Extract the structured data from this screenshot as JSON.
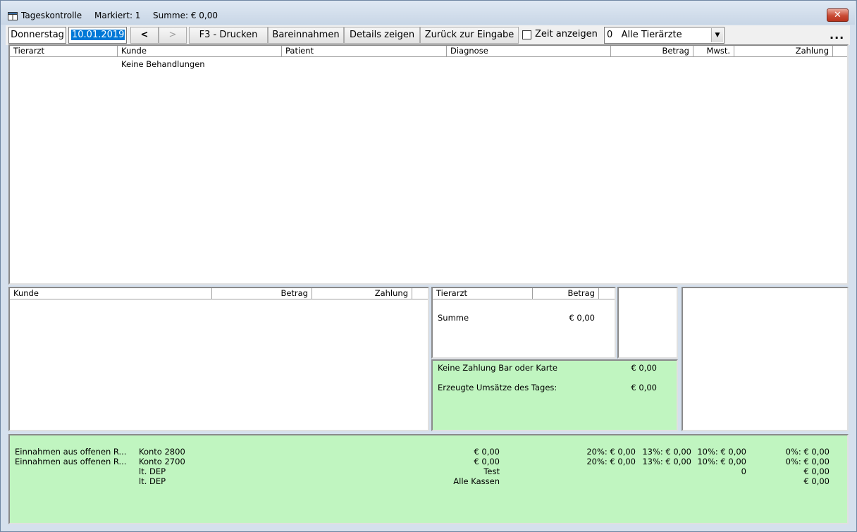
{
  "titlebar": {
    "app_title": "Tageskontrolle",
    "marked": "Markiert: 1",
    "sum": "Summe: € 0,00",
    "close_glyph": "✕"
  },
  "toolbar": {
    "weekday": "Donnerstag",
    "date": "10.01.2019",
    "prev_label": "<",
    "next_label": ">",
    "print_label": "F3 - Drucken",
    "cash_label": "Bareinnahmen",
    "details_label": "Details zeigen",
    "back_label": "Zurück zur Eingabe",
    "show_time_label": "Zeit anzeigen",
    "vet_select": "0   Alle Tierärzte",
    "more_label": "..."
  },
  "treatments_table": {
    "columns": [
      "Tierarzt",
      "Kunde",
      "Patient",
      "Diagnose",
      "Betrag",
      "Mwst.",
      "Zahlung"
    ],
    "empty_text": "Keine Behandlungen"
  },
  "customers_table": {
    "columns": [
      "Kunde",
      "Betrag",
      "Zahlung"
    ]
  },
  "vet_table": {
    "columns": [
      "Tierarzt",
      "Betrag"
    ],
    "sum_label": "Summe",
    "sum_value": "€ 0,00"
  },
  "day_summary": {
    "no_payment_label": "Keine Zahlung Bar oder Karte",
    "no_payment_value": "€ 0,00",
    "revenue_label": "Erzeugte Umsätze des Tages:",
    "revenue_value": "€ 0,00"
  },
  "footer_rows": [
    {
      "desc": "Einnahmen aus offenen R...",
      "account": "Konto 2800",
      "amount": "€ 0,00",
      "v20": "20%: € 0,00",
      "v13": "13%: € 0,00",
      "v10": "10%: € 0,00",
      "v0": "0%: € 0,00"
    },
    {
      "desc": "Einnahmen aus offenen R...",
      "account": "Konto 2700",
      "amount": "€ 0,00",
      "v20": "20%: € 0,00",
      "v13": "13%: € 0,00",
      "v10": "10%: € 0,00",
      "v0": "0%: € 0,00"
    },
    {
      "desc": "",
      "account": "lt. DEP",
      "amount": "Test",
      "v20": "",
      "v13": "",
      "v10": "0",
      "v0": "€ 0,00"
    },
    {
      "desc": "",
      "account": "lt. DEP",
      "amount": "Alle Kassen",
      "v20": "",
      "v13": "",
      "v10": "",
      "v0": "€ 0,00"
    }
  ],
  "colors": {
    "summary_green": "#c0f5c0",
    "selection_blue": "#0078d7",
    "close_red": "#c94b35"
  }
}
